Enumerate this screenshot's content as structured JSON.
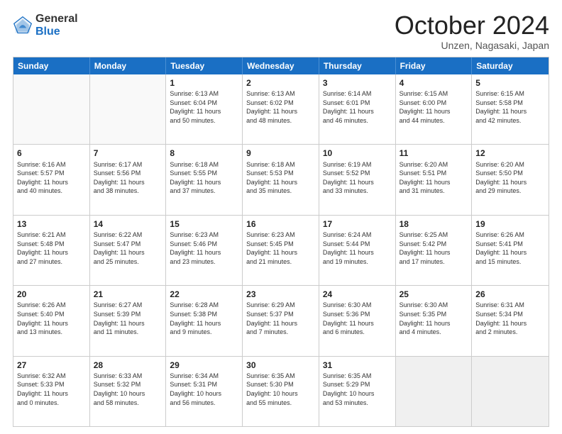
{
  "header": {
    "logo_general": "General",
    "logo_blue": "Blue",
    "month_title": "October 2024",
    "location": "Unzen, Nagasaki, Japan"
  },
  "weekdays": [
    "Sunday",
    "Monday",
    "Tuesday",
    "Wednesday",
    "Thursday",
    "Friday",
    "Saturday"
  ],
  "rows": [
    [
      {
        "day": "",
        "info": "",
        "empty": true
      },
      {
        "day": "",
        "info": "",
        "empty": true
      },
      {
        "day": "1",
        "info": "Sunrise: 6:13 AM\nSunset: 6:04 PM\nDaylight: 11 hours\nand 50 minutes."
      },
      {
        "day": "2",
        "info": "Sunrise: 6:13 AM\nSunset: 6:02 PM\nDaylight: 11 hours\nand 48 minutes."
      },
      {
        "day": "3",
        "info": "Sunrise: 6:14 AM\nSunset: 6:01 PM\nDaylight: 11 hours\nand 46 minutes."
      },
      {
        "day": "4",
        "info": "Sunrise: 6:15 AM\nSunset: 6:00 PM\nDaylight: 11 hours\nand 44 minutes."
      },
      {
        "day": "5",
        "info": "Sunrise: 6:15 AM\nSunset: 5:58 PM\nDaylight: 11 hours\nand 42 minutes."
      }
    ],
    [
      {
        "day": "6",
        "info": "Sunrise: 6:16 AM\nSunset: 5:57 PM\nDaylight: 11 hours\nand 40 minutes."
      },
      {
        "day": "7",
        "info": "Sunrise: 6:17 AM\nSunset: 5:56 PM\nDaylight: 11 hours\nand 38 minutes."
      },
      {
        "day": "8",
        "info": "Sunrise: 6:18 AM\nSunset: 5:55 PM\nDaylight: 11 hours\nand 37 minutes."
      },
      {
        "day": "9",
        "info": "Sunrise: 6:18 AM\nSunset: 5:53 PM\nDaylight: 11 hours\nand 35 minutes."
      },
      {
        "day": "10",
        "info": "Sunrise: 6:19 AM\nSunset: 5:52 PM\nDaylight: 11 hours\nand 33 minutes."
      },
      {
        "day": "11",
        "info": "Sunrise: 6:20 AM\nSunset: 5:51 PM\nDaylight: 11 hours\nand 31 minutes."
      },
      {
        "day": "12",
        "info": "Sunrise: 6:20 AM\nSunset: 5:50 PM\nDaylight: 11 hours\nand 29 minutes."
      }
    ],
    [
      {
        "day": "13",
        "info": "Sunrise: 6:21 AM\nSunset: 5:48 PM\nDaylight: 11 hours\nand 27 minutes."
      },
      {
        "day": "14",
        "info": "Sunrise: 6:22 AM\nSunset: 5:47 PM\nDaylight: 11 hours\nand 25 minutes."
      },
      {
        "day": "15",
        "info": "Sunrise: 6:23 AM\nSunset: 5:46 PM\nDaylight: 11 hours\nand 23 minutes."
      },
      {
        "day": "16",
        "info": "Sunrise: 6:23 AM\nSunset: 5:45 PM\nDaylight: 11 hours\nand 21 minutes."
      },
      {
        "day": "17",
        "info": "Sunrise: 6:24 AM\nSunset: 5:44 PM\nDaylight: 11 hours\nand 19 minutes."
      },
      {
        "day": "18",
        "info": "Sunrise: 6:25 AM\nSunset: 5:42 PM\nDaylight: 11 hours\nand 17 minutes."
      },
      {
        "day": "19",
        "info": "Sunrise: 6:26 AM\nSunset: 5:41 PM\nDaylight: 11 hours\nand 15 minutes."
      }
    ],
    [
      {
        "day": "20",
        "info": "Sunrise: 6:26 AM\nSunset: 5:40 PM\nDaylight: 11 hours\nand 13 minutes."
      },
      {
        "day": "21",
        "info": "Sunrise: 6:27 AM\nSunset: 5:39 PM\nDaylight: 11 hours\nand 11 minutes."
      },
      {
        "day": "22",
        "info": "Sunrise: 6:28 AM\nSunset: 5:38 PM\nDaylight: 11 hours\nand 9 minutes."
      },
      {
        "day": "23",
        "info": "Sunrise: 6:29 AM\nSunset: 5:37 PM\nDaylight: 11 hours\nand 7 minutes."
      },
      {
        "day": "24",
        "info": "Sunrise: 6:30 AM\nSunset: 5:36 PM\nDaylight: 11 hours\nand 6 minutes."
      },
      {
        "day": "25",
        "info": "Sunrise: 6:30 AM\nSunset: 5:35 PM\nDaylight: 11 hours\nand 4 minutes."
      },
      {
        "day": "26",
        "info": "Sunrise: 6:31 AM\nSunset: 5:34 PM\nDaylight: 11 hours\nand 2 minutes."
      }
    ],
    [
      {
        "day": "27",
        "info": "Sunrise: 6:32 AM\nSunset: 5:33 PM\nDaylight: 11 hours\nand 0 minutes."
      },
      {
        "day": "28",
        "info": "Sunrise: 6:33 AM\nSunset: 5:32 PM\nDaylight: 10 hours\nand 58 minutes."
      },
      {
        "day": "29",
        "info": "Sunrise: 6:34 AM\nSunset: 5:31 PM\nDaylight: 10 hours\nand 56 minutes."
      },
      {
        "day": "30",
        "info": "Sunrise: 6:35 AM\nSunset: 5:30 PM\nDaylight: 10 hours\nand 55 minutes."
      },
      {
        "day": "31",
        "info": "Sunrise: 6:35 AM\nSunset: 5:29 PM\nDaylight: 10 hours\nand 53 minutes."
      },
      {
        "day": "",
        "info": "",
        "empty": true,
        "shaded": true
      },
      {
        "day": "",
        "info": "",
        "empty": true,
        "shaded": true
      }
    ]
  ]
}
